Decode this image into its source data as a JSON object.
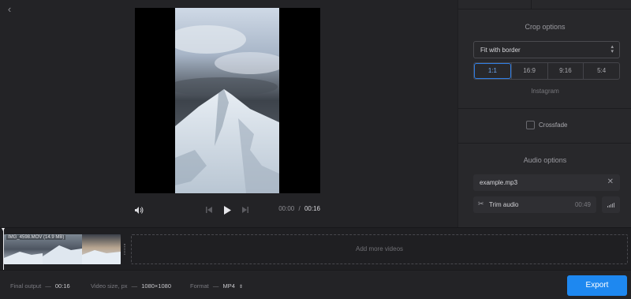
{
  "header": {
    "back_icon": "chevron-left-icon"
  },
  "player": {
    "time_current": "00:00",
    "time_separator": "/",
    "time_total": "00:16",
    "icons": [
      "volume-icon",
      "skip-back-icon",
      "play-icon",
      "skip-forward-icon"
    ]
  },
  "crop_options": {
    "title": "Crop options",
    "fit_value": "Fit with border",
    "ratios": [
      "1:1",
      "16:9",
      "9:16",
      "5:4"
    ],
    "active_ratio": "1:1",
    "platform": "Instagram"
  },
  "crossfade": {
    "label": "Crossfade",
    "checked": false
  },
  "audio_options": {
    "title": "Audio options",
    "file_name": "example.mp3",
    "trim_label": "Trim audio",
    "trim_duration": "00:49"
  },
  "timeline": {
    "clip_label": "IMG_4598.MOV (14.9 MB)",
    "add_more_label": "Add more videos"
  },
  "footer": {
    "final_output_label": "Final output",
    "final_output_value": "00:16",
    "video_size_label": "Video size, px",
    "video_size_value": "1080×1080",
    "format_label": "Format",
    "format_value": "MP4",
    "dash": "—",
    "export_label": "Export"
  },
  "colors": {
    "accent": "#1e88f0",
    "background": "#232326",
    "panel": "#28282b"
  }
}
